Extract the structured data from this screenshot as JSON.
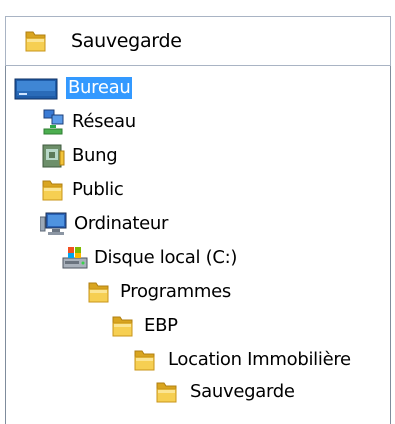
{
  "combo": {
    "selected_label": "Sauvegarde",
    "icon": "folder-icon"
  },
  "tree": {
    "items": [
      {
        "label": "Bureau",
        "icon": "desktop-icon",
        "level": 0,
        "selected": true
      },
      {
        "label": "Réseau",
        "icon": "network-icon",
        "level": 1
      },
      {
        "label": "Bung",
        "icon": "user-folder-icon",
        "level": 1
      },
      {
        "label": "Public",
        "icon": "folder-icon",
        "level": 1
      },
      {
        "label": "Ordinateur",
        "icon": "computer-icon",
        "level": 1
      },
      {
        "label": "Disque local (C:)",
        "icon": "drive-icon",
        "level": 2
      },
      {
        "label": "Programmes",
        "icon": "folder-icon",
        "level": 3
      },
      {
        "label": "EBP",
        "icon": "folder-icon",
        "level": 4
      },
      {
        "label": "Location Immobilière",
        "icon": "folder-icon",
        "level": 5
      },
      {
        "label": "Sauvegarde",
        "icon": "folder-icon",
        "level": 6
      }
    ]
  },
  "colors": {
    "selection": "#3399ff",
    "folder": "#f2c43a",
    "border": "#7f8c9c"
  }
}
